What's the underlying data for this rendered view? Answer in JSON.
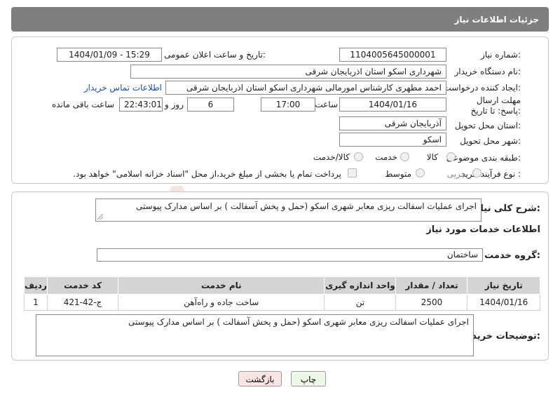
{
  "header": {
    "title": "جزئیات اطلاعات نیاز"
  },
  "fields": {
    "need_number": {
      "label": "شماره نیاز:",
      "value": "1104005645000001"
    },
    "announce_datetime": {
      "label": "تاریخ و ساعت اعلان عمومی:",
      "value": "1404/01/09 - 15:29"
    },
    "buyer_org": {
      "label": "نام دستگاه خریدار:",
      "value": "شهرداری اسکو استان اذربایجان شرقی"
    },
    "requester": {
      "label": "ایجاد کننده درخواست:",
      "value": "احمد مطهری کارشناس امورمالی شهرداری اسکو استان اذربایجان شرقی"
    },
    "buyer_contact_link": "اطلاعات تماس خریدار",
    "deadline": {
      "label": "مهلت ارسال پاسخ: تا تاریخ:",
      "date": "1404/01/16",
      "time_label": "ساعت",
      "time": "17:00",
      "days": "6",
      "days_label": "روز و",
      "remaining": "22:43:01",
      "remaining_label": "ساعت باقی مانده"
    },
    "delivery_province": {
      "label": "استان محل تحویل:",
      "value": "آذربایجان شرقی"
    },
    "delivery_city": {
      "label": "شهر محل تحویل:",
      "value": "اسکو"
    },
    "category": {
      "label": "طبقه بندی موضوعی:",
      "options": [
        "کالا",
        "خدمت",
        "کالا/خدمت"
      ]
    },
    "purchase_type": {
      "label": "نوع فرآیند خرید :",
      "options": [
        "جزیی",
        "متوسط"
      ],
      "payment_note": "پرداخت تمام یا بخشی از مبلغ خرید،از محل \"اسناد خزانه اسلامی\" خواهد بود."
    }
  },
  "details": {
    "summary_label": "شرح کلی نیاز:",
    "summary": "اجرای عملیات اسفالت ریزی معابر شهری اسکو (حمل و پخش آسفالت ) بر اساس مدارک پیوستی",
    "services_title": "اطلاعات خدمات مورد نیاز",
    "service_group_label": "گروه خدمت:",
    "service_group": "ساختمان",
    "table": {
      "headers": [
        "ردیف",
        "کد خدمت",
        "نام خدمت",
        "واحد اندازه گیری",
        "تعداد / مقدار",
        "تاریخ نیاز"
      ],
      "rows": [
        [
          "1",
          "ج-42-421",
          "ساخت جاده و راه‌آهن",
          "تن",
          "2500",
          "1404/01/16"
        ]
      ]
    },
    "buyer_notes_label": "توضیحات خریدار:",
    "buyer_notes": "اجرای عملیات اسفالت ریزی معابر شهری اسکو (حمل و پخش آسفالت ) بر اساس مدارک پیوستی"
  },
  "buttons": {
    "print": "چاپ",
    "back": "بازگشت"
  },
  "watermark": {
    "text": "AriaTender.neT"
  },
  "colors": {
    "header": "#7f7f7f",
    "link": "#1a4fb0",
    "print_btn": "#eef8e6",
    "back_btn": "#fbe4e4",
    "watermark": "#c0392b"
  }
}
